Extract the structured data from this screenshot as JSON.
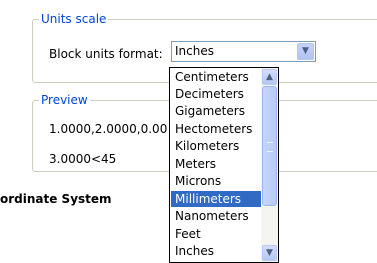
{
  "units_scale": {
    "title": "Units scale",
    "format_label": "Block units format:",
    "selected_value": "Inches"
  },
  "preview": {
    "title": "Preview",
    "line1": "1.0000,2.0000,0.00",
    "line2": "3.0000<45"
  },
  "section_heading": "ordinate System",
  "dropdown": {
    "items": [
      "Centimeters",
      "Decimeters",
      "Gigameters",
      "Hectometers",
      "Kilometers",
      "Meters",
      "Microns",
      "Millimeters",
      "Nanometers",
      "Feet",
      "Inches"
    ],
    "highlighted": "Millimeters"
  },
  "icons": {
    "dropdown_arrow": "chevron-down-icon",
    "scroll_up": "chevron-up-icon",
    "scroll_down": "chevron-down-icon"
  }
}
